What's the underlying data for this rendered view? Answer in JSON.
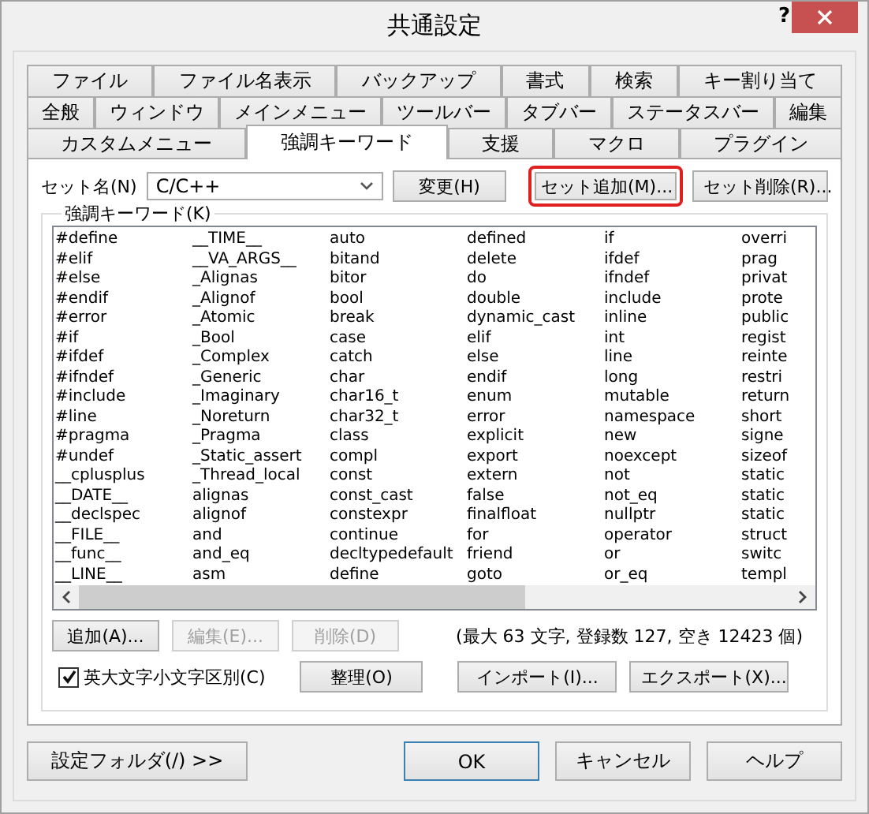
{
  "window": {
    "title": "共通設定",
    "help_button": "?"
  },
  "tab_rows": [
    [
      {
        "label": "ファイル",
        "selected": false
      },
      {
        "label": "ファイル名表示",
        "selected": false
      },
      {
        "label": "バックアップ",
        "selected": false
      },
      {
        "label": "書式",
        "selected": false
      },
      {
        "label": "検索",
        "selected": false
      },
      {
        "label": "キー割り当て",
        "selected": false
      }
    ],
    [
      {
        "label": "全般",
        "selected": false
      },
      {
        "label": "ウィンドウ",
        "selected": false
      },
      {
        "label": "メインメニュー",
        "selected": false
      },
      {
        "label": "ツールバー",
        "selected": false
      },
      {
        "label": "タブバー",
        "selected": false
      },
      {
        "label": "ステータスバー",
        "selected": false
      },
      {
        "label": "編集",
        "selected": false
      }
    ],
    [
      {
        "label": "カスタムメニュー",
        "selected": false
      },
      {
        "label": "強調キーワード",
        "selected": true
      },
      {
        "label": "支援",
        "selected": false
      },
      {
        "label": "マクロ",
        "selected": false
      },
      {
        "label": "プラグイン",
        "selected": false
      }
    ]
  ],
  "keyword_set": {
    "label": "セット名(N)",
    "value": "C/C++",
    "buttons": [
      {
        "label": "変更(H)",
        "highlighted": false
      },
      {
        "label": "セット追加(M)...",
        "highlighted": true
      },
      {
        "label": "セット削除(R)...",
        "highlighted": false
      }
    ]
  },
  "keywords": {
    "label": "強調キーワード(K)",
    "columns": [
      [
        "#define",
        "#elif",
        "#else",
        "#endif",
        "#error",
        "#if",
        "#ifdef",
        "#ifndef",
        "#include",
        "#line",
        "#pragma",
        "#undef",
        "__cplusplus",
        "__DATE__",
        "__declspec",
        "__FILE__",
        "__func__",
        "__LINE__"
      ],
      [
        "__TIME__",
        "__VA_ARGS__",
        "_Alignas",
        "_Alignof",
        "_Atomic",
        "_Bool",
        "_Complex",
        "_Generic",
        "_Imaginary",
        "_Noreturn",
        "_Pragma",
        "_Static_assert",
        "_Thread_local",
        "alignas",
        "alignof",
        "and",
        "and_eq",
        "asm"
      ],
      [
        "auto",
        "bitand",
        "bitor",
        "bool",
        "break",
        "case",
        "catch",
        "char",
        "char16_t",
        "char32_t",
        "class",
        "compl",
        "const",
        "const_cast",
        "constexpr",
        "continue",
        "decltypedefault",
        "define"
      ],
      [
        "defined",
        "delete",
        "do",
        "double",
        "dynamic_cast",
        "elif",
        "else",
        "endif",
        "enum",
        "error",
        "explicit",
        "export",
        "extern",
        "false",
        "finalfloat",
        "for",
        "friend",
        "goto"
      ],
      [
        "if",
        "ifdef",
        "ifndef",
        "include",
        "inline",
        "int",
        "line",
        "long",
        "mutable",
        "namespace",
        "new",
        "noexcept",
        "not",
        "not_eq",
        "nullptr",
        "operator",
        "or",
        "or_eq"
      ],
      [
        "overri",
        "prag",
        "privat",
        "prote",
        "public",
        "regist",
        "reinte",
        "restri",
        "return",
        "short",
        "signe",
        "sizeof",
        "static",
        "static",
        "static",
        "struct",
        "switc",
        "templ"
      ]
    ]
  },
  "list_buttons": [
    {
      "label": "追加(A)...",
      "disabled": false
    },
    {
      "label": "編集(E)...",
      "disabled": true
    },
    {
      "label": "削除(D)",
      "disabled": true
    }
  ],
  "status": "(最大 63 文字, 登録数 127, 空き 12423 個)",
  "case_checkbox": {
    "label": "英大文字小文字区別(C)",
    "checked": true
  },
  "arrange_button": "整理(O)",
  "io_buttons": [
    "インポート(I)...",
    "エクスポート(X)..."
  ],
  "footer": {
    "folder_button": "設定フォルダ(/) >>",
    "buttons": [
      {
        "label": "OK",
        "default": true
      },
      {
        "label": "キャンセル",
        "default": false
      },
      {
        "label": "ヘルプ",
        "default": false
      }
    ]
  }
}
